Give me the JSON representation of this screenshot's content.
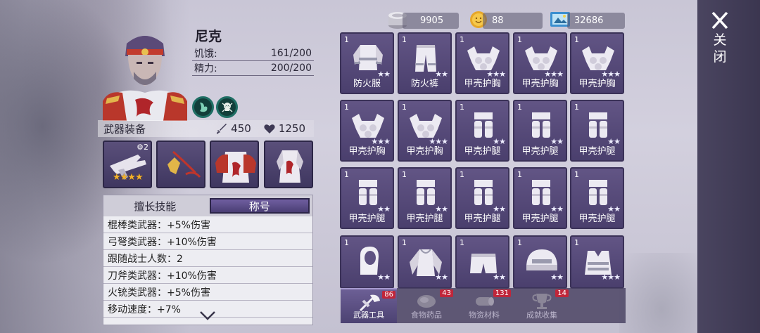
{
  "character": {
    "name": "尼克",
    "hunger_label": "饥饿:",
    "hunger_value": "161/200",
    "energy_label": "精力:",
    "energy_value": "200/200"
  },
  "equipment": {
    "title": "武器装备",
    "attack": "450",
    "health": "1250",
    "weapon_upgrade": "2",
    "weapon_stars": "★★★★"
  },
  "skills": {
    "tabs": [
      "擅长技能",
      "称号"
    ],
    "active_tab": 1,
    "rows": [
      "棍棒类武器：+5%伤害",
      "弓弩类武器：+10%伤害",
      "跟随战士人数：2",
      "刀斧类武器：+10%伤害",
      "火铳类武器：+5%伤害",
      "移动速度：+7%"
    ]
  },
  "currency": {
    "silver": "9905",
    "gold": "88",
    "photo": "32686"
  },
  "inventory": [
    {
      "qty": "1",
      "name": "防火服",
      "icon": "fire-suit-icon",
      "stars": "★★"
    },
    {
      "qty": "1",
      "name": "防火裤",
      "icon": "fire-pants-icon",
      "stars": "★★"
    },
    {
      "qty": "1",
      "name": "甲壳护胸",
      "icon": "chest-armor-icon",
      "stars": "★★★"
    },
    {
      "qty": "1",
      "name": "甲壳护胸",
      "icon": "chest-armor-icon",
      "stars": "★★★"
    },
    {
      "qty": "1",
      "name": "甲壳护胸",
      "icon": "chest-armor-icon",
      "stars": "★★★"
    },
    {
      "qty": "1",
      "name": "甲壳护胸",
      "icon": "chest-armor-icon",
      "stars": "★★★"
    },
    {
      "qty": "1",
      "name": "甲壳护胸",
      "icon": "chest-armor-icon",
      "stars": "★★★"
    },
    {
      "qty": "1",
      "name": "甲壳护腿",
      "icon": "leg-armor-icon",
      "stars": "★★"
    },
    {
      "qty": "1",
      "name": "甲壳护腿",
      "icon": "leg-armor-icon",
      "stars": "★★"
    },
    {
      "qty": "1",
      "name": "甲壳护腿",
      "icon": "leg-armor-icon",
      "stars": "★★"
    },
    {
      "qty": "1",
      "name": "甲壳护腿",
      "icon": "leg-armor-icon",
      "stars": "★★"
    },
    {
      "qty": "1",
      "name": "甲壳护腿",
      "icon": "leg-armor-icon",
      "stars": "★★"
    },
    {
      "qty": "1",
      "name": "甲壳护腿",
      "icon": "leg-armor-icon",
      "stars": "★★"
    },
    {
      "qty": "1",
      "name": "甲壳护腿",
      "icon": "leg-armor-icon",
      "stars": "★★"
    },
    {
      "qty": "1",
      "name": "甲壳护腿",
      "icon": "leg-armor-icon",
      "stars": "★★"
    },
    {
      "qty": "1",
      "name": "",
      "icon": "hood-icon",
      "stars": "★★"
    },
    {
      "qty": "1",
      "name": "",
      "icon": "hoodie-icon",
      "stars": "★★"
    },
    {
      "qty": "1",
      "name": "",
      "icon": "shorts-icon",
      "stars": "★★"
    },
    {
      "qty": "1",
      "name": "",
      "icon": "helmet-icon",
      "stars": "★★"
    },
    {
      "qty": "1",
      "name": "",
      "icon": "vest-icon",
      "stars": "★★★"
    }
  ],
  "bottom_tabs": [
    {
      "label": "武器工具",
      "badge": "86",
      "icon": "axe-icon"
    },
    {
      "label": "食物药品",
      "badge": "43",
      "icon": "meat-icon"
    },
    {
      "label": "物资材料",
      "badge": "131",
      "icon": "log-icon"
    },
    {
      "label": "成就收集",
      "badge": "14",
      "icon": "trophy-icon"
    }
  ],
  "close_label": "关闭"
}
